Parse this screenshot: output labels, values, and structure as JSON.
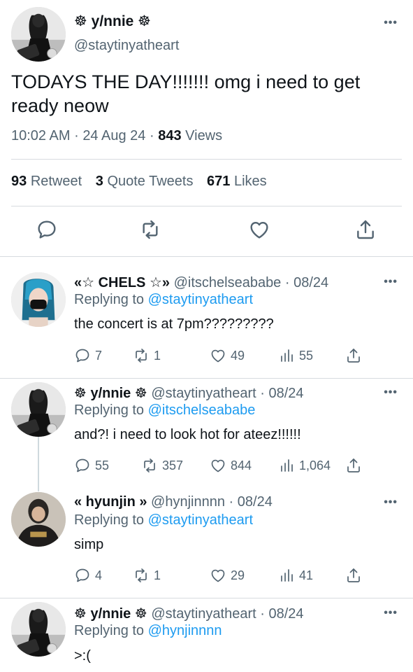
{
  "main_tweet": {
    "display_name": "☸ y/nnie ☸",
    "handle": "@staytinyatheart",
    "text": "TODAYS THE DAY!!!!!!! omg i need to get ready neow",
    "time": "10:02 AM",
    "date": "24 Aug 24",
    "views_count": "843",
    "views_label": "Views",
    "retweets_count": "93",
    "retweets_label": "Retweet",
    "quotes_count": "3",
    "quotes_label": "Quote Tweets",
    "likes_count": "671",
    "likes_label": "Likes",
    "more": "•••"
  },
  "separator": "·",
  "replies": [
    {
      "display_name": "«☆ CHELS ☆»",
      "handle": "@itschelseababe",
      "date": "08/24",
      "replying_prefix": "Replying to",
      "replying_to": "@staytinyatheart",
      "text": "the concert is at 7pm?????????",
      "replies": "7",
      "retweets": "1",
      "likes": "49",
      "views": "55"
    },
    {
      "display_name": "☸ y/nnie ☸",
      "handle": "@staytinyatheart",
      "date": "08/24",
      "replying_prefix": "Replying to",
      "replying_to": "@itschelseababe",
      "text": "and?! i need to look hot for ateez!!!!!!",
      "replies": "55",
      "retweets": "357",
      "likes": "844",
      "views": "1,064"
    },
    {
      "display_name": "« hyunjin »",
      "handle": "@hynjinnnn",
      "date": "08/24",
      "replying_prefix": "Replying to",
      "replying_to": "@staytinyatheart",
      "text": "simp",
      "replies": "4",
      "retweets": "1",
      "likes": "29",
      "views": "41"
    },
    {
      "display_name": "☸ y/nnie ☸",
      "handle": "@staytinyatheart",
      "date": "08/24",
      "replying_prefix": "Replying to",
      "replying_to": "@hynjinnnn",
      "text": ">:("
    }
  ],
  "icons": {
    "reply": "reply-icon",
    "retweet": "retweet-icon",
    "like": "heart-icon",
    "share": "share-icon",
    "views": "views-icon",
    "more": "more-icon"
  },
  "colors": {
    "link": "#1d9bf0",
    "muted": "#536471",
    "text": "#0f1419",
    "divider": "#d7dbdf"
  }
}
